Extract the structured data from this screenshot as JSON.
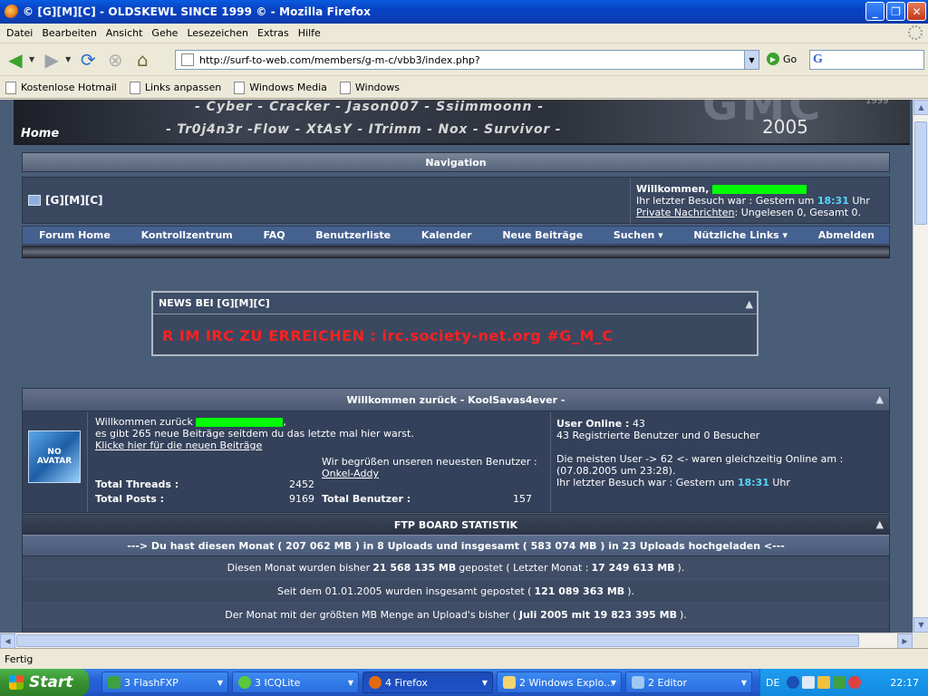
{
  "window": {
    "title": "© [G][M][C] - OLDSKEWL SINCE 1999 © - Mozilla Firefox",
    "buttons": [
      "_",
      "❐",
      "✕"
    ]
  },
  "menu": [
    "Datei",
    "Bearbeiten",
    "Ansicht",
    "Gehe",
    "Lesezeichen",
    "Extras",
    "Hilfe"
  ],
  "toolbar": {
    "url": "http://surf-to-web.com/members/g-m-c/vbb3/index.php?",
    "go_label": "Go",
    "search_icon": "G"
  },
  "bookmarks": [
    "Kostenlose Hotmail",
    "Links anpassen",
    "Windows Media",
    "Windows"
  ],
  "banner": {
    "home": "Home",
    "names_top": "- Cyber - Cracker - Jason007 - Ssiimmoonn -",
    "names_bottom": "- Tr0j4n3r -Flow - XtAsY - ITrimm - Nox - Survivor -",
    "logo": "GMC",
    "year": "2005",
    "small_year": "1999"
  },
  "nav": {
    "header": "Navigation",
    "site_name": "[G][M][C]",
    "welcome": "Willkommen,",
    "last_visit_prefix": "Ihr letzter Besuch war : Gestern um",
    "last_visit_time": "18:31",
    "last_visit_suffix": "Uhr",
    "pm_link": "Private Nachrichten",
    "pm_status": ": Ungelesen 0, Gesamt 0.",
    "menu": [
      "Forum Home",
      "Kontrollzentrum",
      "FAQ",
      "Benutzerliste",
      "Kalender",
      "Neue Beiträge",
      "Suchen ▾",
      "Nützliche Links ▾",
      "Abmelden"
    ]
  },
  "news": {
    "header": "NEWS BEI [G][M][C]",
    "message": "R IM IRC ZU ERREICHEN : irc.society-net.org #G_M_C"
  },
  "welcome_block": {
    "header": "Willkommen zurück - KoolSavas4ever -",
    "avatar_text": "NO AVATAR",
    "greeting": "Willkommen zurück",
    "new_posts": "es gibt 265 neue Beiträge seitdem du das letzte mal hier warst.",
    "new_posts_link": "Klicke hier für die neuen Beiträge",
    "newest_member_text": "Wir begrüßen unseren neuesten Benutzer :",
    "newest_member": "Onkel-Addy",
    "total_threads_label": "Total Threads :",
    "total_threads": "2452",
    "total_posts_label": "Total Posts :",
    "total_posts": "9169",
    "total_users_label": "Total Benutzer :",
    "total_users": "157",
    "online_label": "User Online :",
    "online_count": "43",
    "registered": "43 Registrierte Benutzer und 0 Besucher",
    "max_users": "Die meisten User -> 62 <- waren gleichzeitig Online am : (07.08.2005 um 23:28).",
    "last_visit_prefix": "Ihr letzter Besuch war : Gestern um",
    "last_visit_time": "18:31",
    "last_visit_suffix": "Uhr"
  },
  "ftp": {
    "header": "FTP BOARD STATISTIK",
    "sub": "---> Du hast diesen Monat ( 207 062 MB ) in 8 Uploads und insgesamt ( 583 074 MB ) in 23 Uploads hochgeladen <---",
    "row1_a": "Diesen Monat wurden bisher",
    "row1_b": "21 568 135 MB",
    "row1_c": "gepostet ( Letzter Monat :",
    "row1_d": "17 249 613 MB",
    "row1_e": ").",
    "row2_a": "Seit dem 01.01.2005 wurden insgesamt gepostet (",
    "row2_b": "121 089 363 MB",
    "row2_c": ").",
    "row3_a": "Der Monat mit der größten MB Menge an Upload's bisher (",
    "row3_b": "Juli 2005 mit 19 823 395 MB",
    "row3_c": ")."
  },
  "status": "Fertig",
  "taskbar": {
    "start": "Start",
    "buttons": [
      "3 FlashFXP",
      "3 ICQLite",
      "4 Firefox",
      "2 Windows Explo...",
      "2 Editor"
    ],
    "lang": "DE",
    "clock": "22:17"
  }
}
